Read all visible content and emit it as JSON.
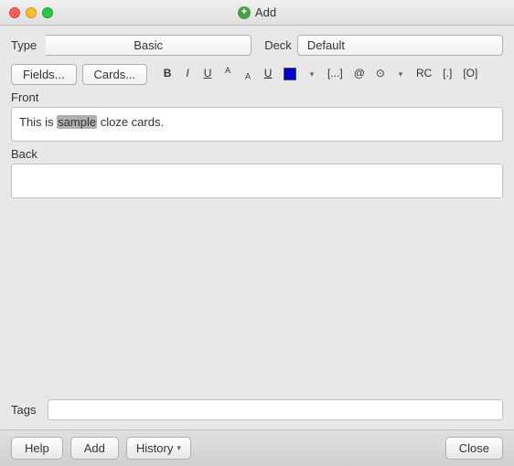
{
  "titleBar": {
    "title": "Add",
    "addIconSymbol": "+"
  },
  "typeRow": {
    "typeLabel": "Type",
    "typeValue": "Basic",
    "deckLabel": "Deck",
    "deckValue": "Default"
  },
  "buttons": {
    "fields": "Fields...",
    "cards": "Cards..."
  },
  "toolbar": {
    "bold": "B",
    "italic": "I",
    "underline": "U",
    "superscript": "A",
    "subscript": "A",
    "strikethrough": "U̲",
    "ellipsis": "[...]",
    "at": "@",
    "target": "⊙",
    "RC": "RC",
    "brackets": "[.]",
    "squareBrackets": "[O]",
    "dropdownArrow": "▾"
  },
  "fields": {
    "frontLabel": "Front",
    "frontValue": "This is sample cloze cards.",
    "frontSampleWord": "sample",
    "backLabel": "Back",
    "backValue": ""
  },
  "tagsRow": {
    "label": "Tags",
    "value": ""
  },
  "bottomBar": {
    "helpLabel": "Help",
    "addLabel": "Add",
    "historyLabel": "History",
    "closeLabel": "Close"
  }
}
